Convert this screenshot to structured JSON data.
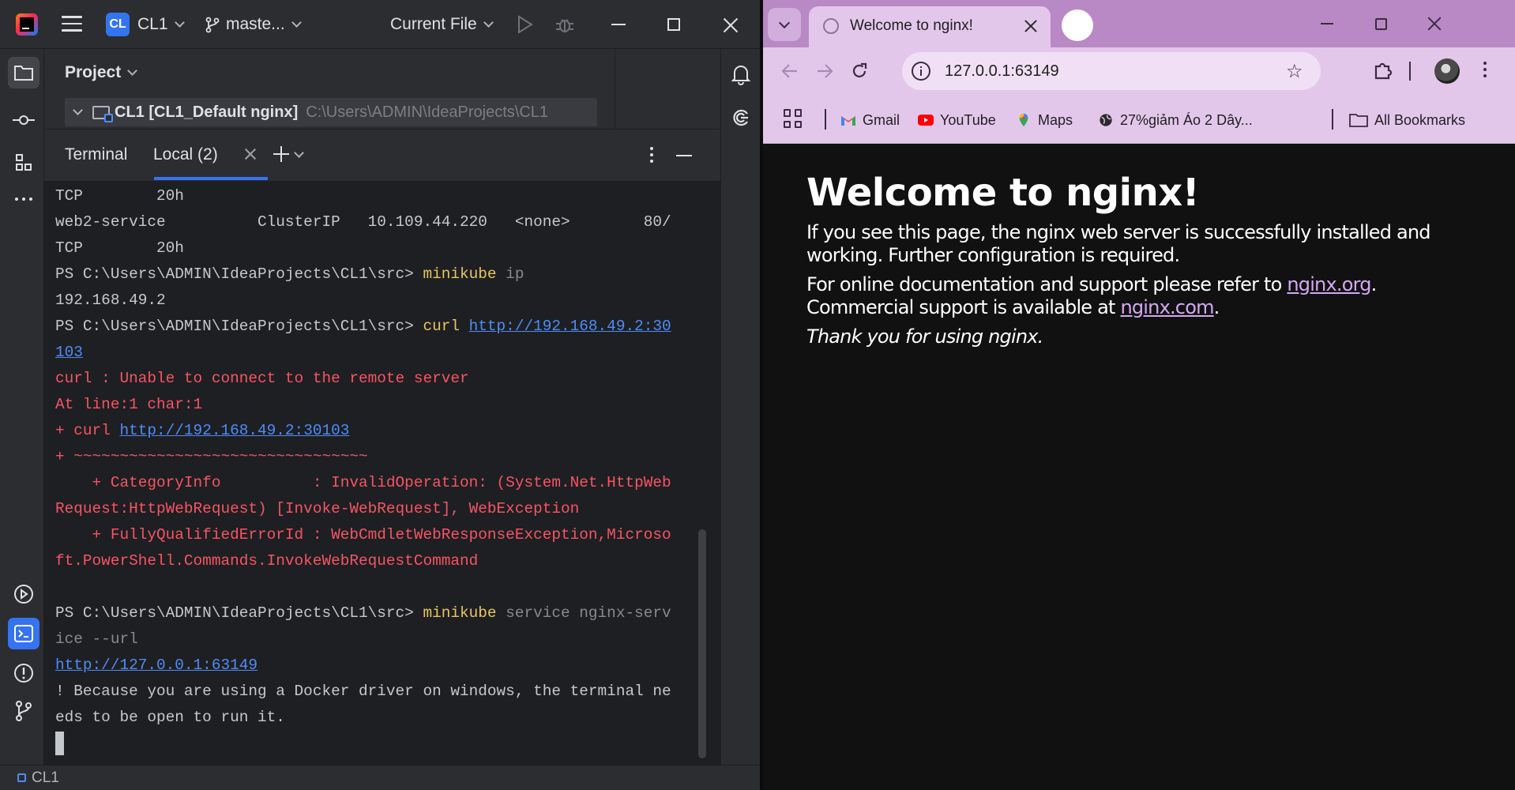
{
  "ide": {
    "project_badge": "CL",
    "project_name": "CL1",
    "branch": "maste...",
    "run_config": "Current File",
    "project_panel_title": "Project",
    "tree_root_name": "CL1 [CL1_Default nginx]",
    "tree_root_path": "C:\\Users\\ADMIN\\IdeaProjects\\CL1",
    "terminal_title": "Terminal",
    "terminal_tab": "Local (2)",
    "terminal_lines": [
      [
        {
          "t": "TCP        20h",
          "c": "w"
        }
      ],
      [
        {
          "t": "web2-service          ClusterIP   10.109.44.220   <none>        80/",
          "c": "w"
        }
      ],
      [
        {
          "t": "TCP        20h",
          "c": "w"
        }
      ],
      [
        {
          "t": "PS C:\\Users\\ADMIN\\IdeaProjects\\CL1\\src> ",
          "c": "w"
        },
        {
          "t": "minikube",
          "c": "y"
        },
        {
          "t": " ip",
          "c": "g"
        }
      ],
      [
        {
          "t": "192.168.49.2",
          "c": "w"
        }
      ],
      [
        {
          "t": "PS C:\\Users\\ADMIN\\IdeaProjects\\CL1\\src> ",
          "c": "w"
        },
        {
          "t": "curl",
          "c": "y"
        },
        {
          "t": " ",
          "c": "w"
        },
        {
          "t": "http://192.168.49.2:30",
          "c": "l"
        }
      ],
      [
        {
          "t": "103",
          "c": "l"
        }
      ],
      [
        {
          "t": "curl : Unable to connect to the remote server",
          "c": "r"
        }
      ],
      [
        {
          "t": "At line:1 char:1",
          "c": "r"
        }
      ],
      [
        {
          "t": "+ curl ",
          "c": "r"
        },
        {
          "t": "http://192.168.49.2:30103",
          "c": "l"
        }
      ],
      [
        {
          "t": "+ ~~~~~~~~~~~~~~~~~~~~~~~~~~~~~~~~",
          "c": "r"
        }
      ],
      [
        {
          "t": "    + CategoryInfo          : InvalidOperation: (System.Net.HttpWeb",
          "c": "r"
        }
      ],
      [
        {
          "t": "Request:HttpWebRequest) [Invoke-WebRequest], WebException",
          "c": "r"
        }
      ],
      [
        {
          "t": "    + FullyQualifiedErrorId : WebCmdletWebResponseException,Microso",
          "c": "r"
        }
      ],
      [
        {
          "t": "ft.PowerShell.Commands.InvokeWebRequestCommand",
          "c": "r"
        }
      ],
      [
        {
          "t": "",
          "c": "w"
        }
      ],
      [
        {
          "t": "PS C:\\Users\\ADMIN\\IdeaProjects\\CL1\\src> ",
          "c": "w"
        },
        {
          "t": "minikube",
          "c": "y"
        },
        {
          "t": " service nginx-serv",
          "c": "g"
        }
      ],
      [
        {
          "t": "ice --url",
          "c": "g"
        }
      ],
      [
        {
          "t": "http://127.0.0.1:63149",
          "c": "l"
        }
      ],
      [
        {
          "t": "! Because you are using a Docker driver on windows, the terminal ne",
          "c": "w"
        }
      ],
      [
        {
          "t": "eds to be open to run it.",
          "c": "w"
        }
      ]
    ],
    "status_project": "CL1"
  },
  "browser": {
    "tab_title": "Welcome to nginx!",
    "url": "127.0.0.1:63149",
    "bookmarks": [
      "Gmail",
      "YouTube",
      "Maps",
      "27%giảm Áo 2 Dây..."
    ],
    "all_bookmarks": "All Bookmarks",
    "page": {
      "heading": "Welcome to nginx!",
      "p1": "If you see this page, the nginx web server is successfully installed and working. Further configuration is required.",
      "p2_pre": "For online documentation and support please refer to ",
      "p2_link1": "nginx.org",
      "p2_mid": ". ",
      "p2_line2_pre": "Commercial support is available at ",
      "p2_link2": "nginx.com",
      "p2_end": ".",
      "p3": "Thank you for using nginx."
    }
  },
  "colors": {
    "ide_accent": "#3574f0",
    "terminal_error": "#f75464",
    "terminal_command": "#e8c462",
    "browser_theme": "#e3c7eb"
  }
}
